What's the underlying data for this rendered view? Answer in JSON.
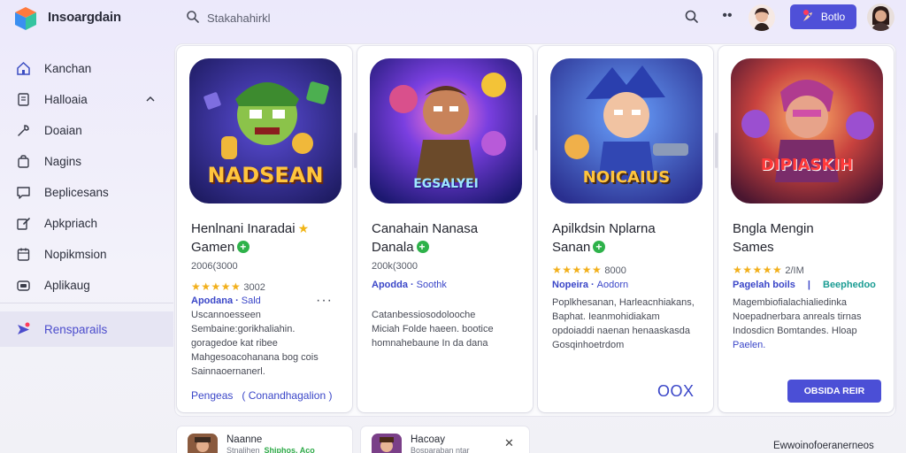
{
  "app": {
    "title": "Insoargdain"
  },
  "search": {
    "placeholder": "Stakahahirkl"
  },
  "topbar": {
    "button_label": "Botlo"
  },
  "sidebar": {
    "items": [
      {
        "label": "Kanchan",
        "icon": "home-icon"
      },
      {
        "label": "Halloaia",
        "icon": "document-icon"
      },
      {
        "label": "Doaian",
        "icon": "wrench-icon"
      },
      {
        "label": "Nagins",
        "icon": "bag-icon"
      },
      {
        "label": "Beplicesans",
        "icon": "chat-icon"
      },
      {
        "label": "Apkpriach",
        "icon": "edit-icon"
      },
      {
        "label": "Nopikmsion",
        "icon": "calendar-icon"
      },
      {
        "label": "Aplikaug",
        "icon": "gamepad-icon"
      }
    ],
    "active_item": {
      "label": "Rensparails",
      "icon": "send-icon"
    }
  },
  "cards": [
    {
      "art_text": "NADSEAN",
      "title": "Henlnani Inaradai",
      "title2": "Gamen",
      "subtitle": "2006(3000",
      "rating_count": "3002",
      "link1": "Apodana",
      "link2": "Sald",
      "desc_lines": [
        "Uscannoesseen",
        "Sembaine:gorikhaliahin.",
        "goragedoe kat ribee",
        "Mahgesoacohanana bog cois",
        "Sainnaoernanerl."
      ],
      "foot": "Pengeas",
      "foot2": "Conandhagalion"
    },
    {
      "art_text": "EGSALYEI",
      "title": "Canahain Nanasa",
      "title2": "Danala",
      "subtitle": "200k(3000",
      "link1": "Apodda",
      "link2": "Soothk",
      "desc_lines": [
        "Catanbessiosodolooche",
        "Miciah Folde haeen. bootice",
        "homnahebaune In da dana"
      ]
    },
    {
      "art_text": "NOICAIUS",
      "title": "Apilkdsin Nplarna",
      "title2": "Sanan",
      "rating_count": "8000",
      "link1": "Nopeira",
      "link2": "Aodorn",
      "desc_lines": [
        "Poplkhesanan, Harleacnhiakans,",
        "Baphat. Ieanmohidiakam",
        "opdoiaddi naenan henaaskasda",
        "Gosqinhoetrdom"
      ],
      "foot": "OOX"
    },
    {
      "art_text": "DIPIASKIH",
      "title": "Bngla Mengin",
      "title2": "Sames",
      "rating_count": "2/IM",
      "link1": "Pagelah boils",
      "link2": "Beephedoo",
      "desc_lines": [
        "Magembiofialachialiedinka",
        "Noepadnerbara anreals tirnas",
        "Indosdicn Bomtandes. Hloap",
        "Paelen."
      ],
      "cta": "OBSIDA REIR"
    }
  ],
  "bottom": [
    {
      "title": "Naanne",
      "sub": "Stnalihen",
      "sub_green": "Shiphos. Aco"
    },
    {
      "title": "Hacoay",
      "sub": "Bosparaban ntar"
    },
    {
      "right_text": "Ewwoinofoeranerneos"
    }
  ],
  "colors": {
    "accent": "#4f50d8",
    "link": "#3a46c8",
    "star": "#f2b01c",
    "verified": "#2eb24a"
  }
}
